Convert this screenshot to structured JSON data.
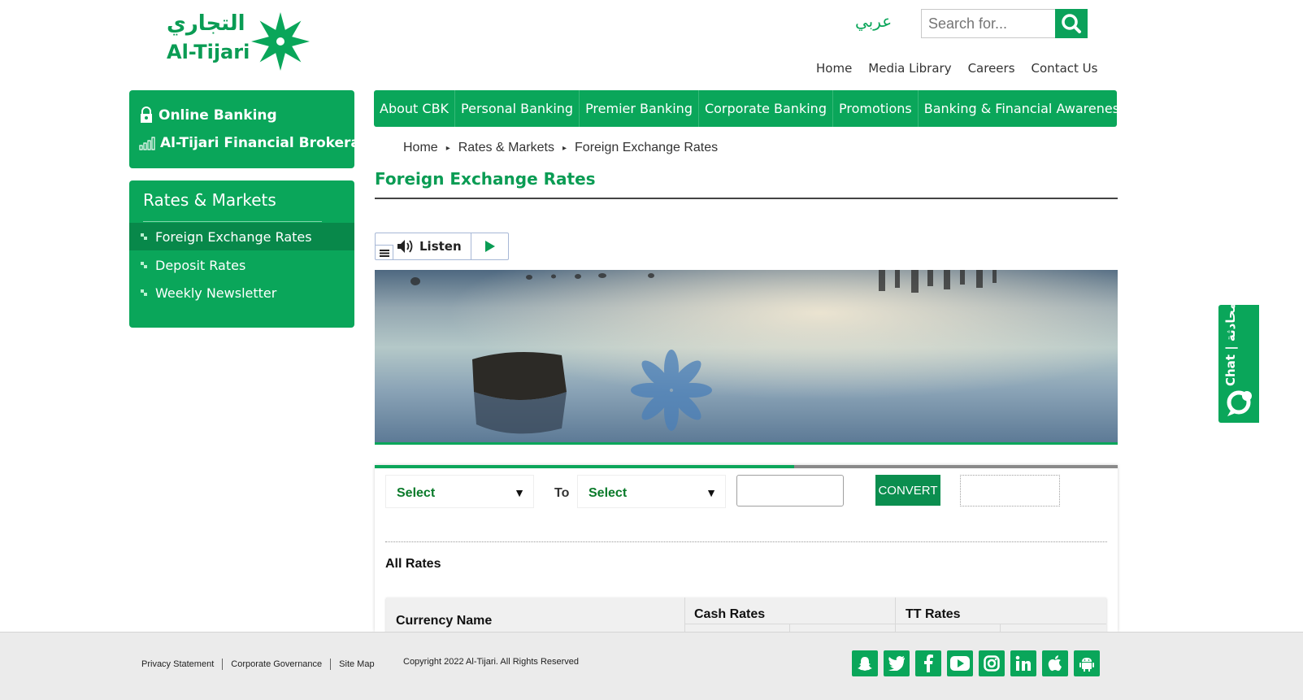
{
  "brand": {
    "name_ar": "التجاري",
    "name_en": "Al-Tijari",
    "color": "#0aa65a"
  },
  "header": {
    "lang_link": "عربي",
    "search_placeholder": "Search for...",
    "top_links": [
      "Home",
      "Media Library",
      "Careers",
      "Contact Us"
    ]
  },
  "quick_links": {
    "online_banking": "Online Banking",
    "brokerage": "Al-Tijari Financial Brokerage"
  },
  "sidebar": {
    "title": "Rates & Markets",
    "items": [
      {
        "label": "Foreign Exchange Rates",
        "active": true
      },
      {
        "label": "Deposit Rates",
        "active": false
      },
      {
        "label": "Weekly Newsletter",
        "active": false
      }
    ]
  },
  "nav": [
    "About CBK",
    "Personal Banking",
    "Premier Banking",
    "Corporate Banking",
    "Promotions",
    "Banking & Financial Awareness"
  ],
  "breadcrumb": [
    "Home",
    "Rates & Markets",
    "Foreign Exchange Rates"
  ],
  "page_title": "Foreign Exchange Rates",
  "listen": {
    "label": "Listen"
  },
  "converter": {
    "from_select": "Select",
    "to_label": "To",
    "to_select": "Select",
    "convert_label": "CONVERT"
  },
  "rates": {
    "section_title": "All Rates",
    "col_currency": "Currency Name",
    "col_cash": "Cash Rates",
    "col_tt": "TT Rates"
  },
  "chat": {
    "label": "Chat | محادثة"
  },
  "footer": {
    "links": [
      "Privacy Statement",
      "Corporate Governance",
      "Site Map"
    ],
    "copyright": "Copyright 2022 Al-Tijari. All Rights Reserved",
    "social_icons": [
      "snapchat-icon",
      "twitter-icon",
      "facebook-icon",
      "youtube-icon",
      "instagram-icon",
      "linkedin-icon",
      "apple-icon",
      "android-icon"
    ]
  }
}
